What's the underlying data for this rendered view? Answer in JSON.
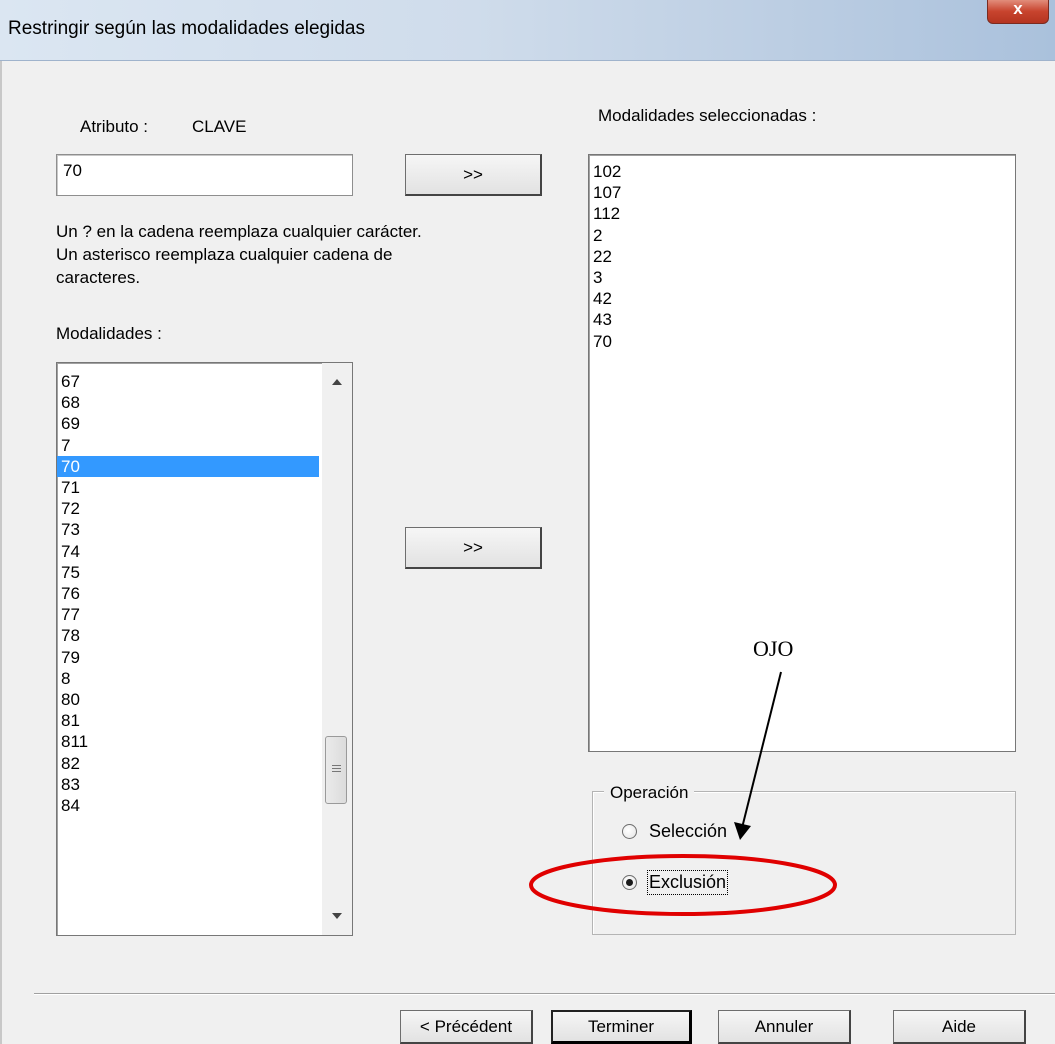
{
  "window": {
    "title": "Restringir según las modalidades elegidas",
    "close_label": "x"
  },
  "attribute": {
    "label": "Atributo :",
    "value": "CLAVE"
  },
  "search": {
    "value": "70"
  },
  "add_button_label": ">>",
  "help_text": {
    "line1": "Un ? en la cadena reemplaza cualquier carácter.",
    "line2": "Un asterisco reemplaza cualquier cadena de",
    "line3": "caracteres."
  },
  "modalities": {
    "label": "Modalidades :",
    "items": [
      "67",
      "68",
      "69",
      "7",
      "70",
      "71",
      "72",
      "73",
      "74",
      "75",
      "76",
      "77",
      "78",
      "79",
      "8",
      "80",
      "81",
      "811",
      "82",
      "83",
      "84"
    ],
    "selected": "70"
  },
  "selected_modalities": {
    "label": "Modalidades seleccionadas :",
    "items": [
      "102",
      "107",
      "112",
      "2",
      "22",
      "3",
      "42",
      "43",
      "70"
    ]
  },
  "operation": {
    "label": "Operación",
    "options": [
      {
        "label": "Selección",
        "checked": false
      },
      {
        "label": "Exclusión",
        "checked": true
      }
    ]
  },
  "annotation": {
    "text": "OJO",
    "color": "#e00000"
  },
  "footer": {
    "previous": "< Précédent",
    "finish": "Terminer",
    "cancel": "Annuler",
    "help": "Aide"
  }
}
